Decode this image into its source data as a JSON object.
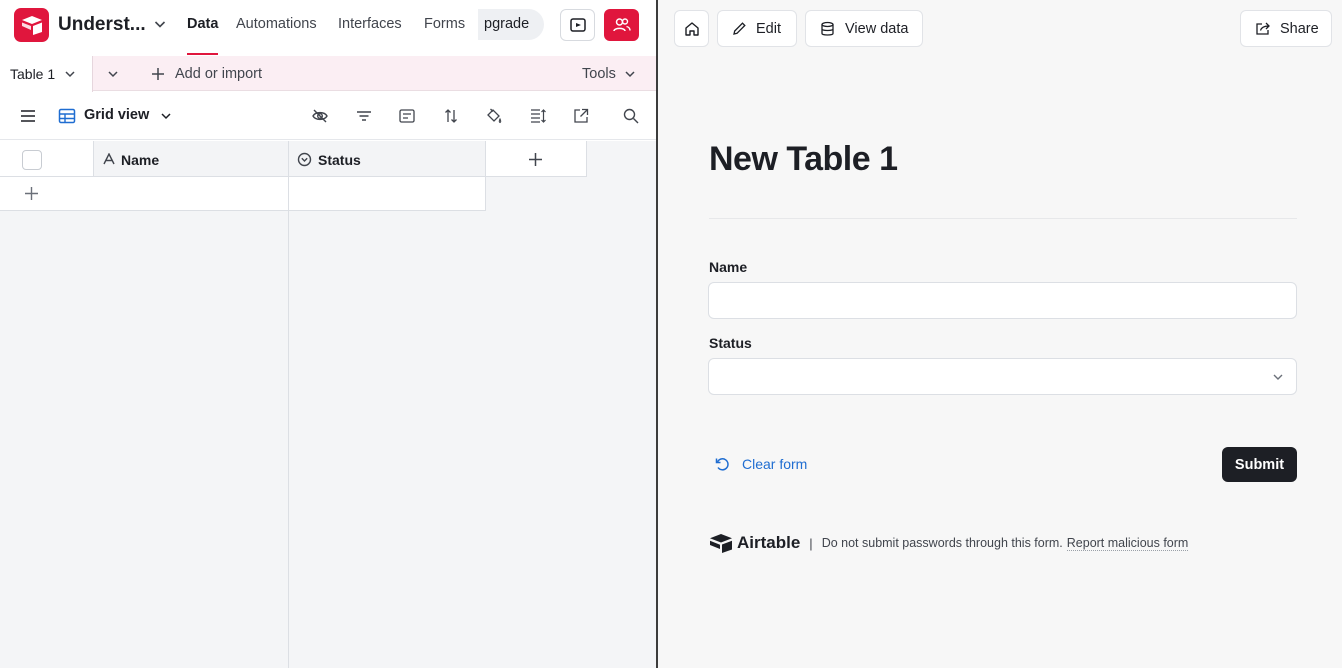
{
  "app": {
    "base_name": "Underst...",
    "nav": [
      "Data",
      "Automations",
      "Interfaces",
      "Forms"
    ],
    "active_nav": "Data",
    "upgrade_label": "pgrade",
    "accent_color": "#e0163d"
  },
  "table_bar": {
    "active_table": "Table 1",
    "add_import_label": "Add or import",
    "tools_label": "Tools"
  },
  "view_bar": {
    "view_name": "Grid view",
    "toolbar_icons": [
      "hide-fields-icon",
      "filter-icon",
      "group-icon",
      "sort-icon",
      "color-icon",
      "row-height-icon",
      "share-view-icon",
      "search-icon"
    ]
  },
  "grid": {
    "columns": [
      {
        "name": "Name",
        "icon": "text-field-icon"
      },
      {
        "name": "Status",
        "icon": "single-select-icon"
      }
    ],
    "rows": []
  },
  "form_toolbar": {
    "edit_label": "Edit",
    "view_data_label": "View data",
    "share_label": "Share"
  },
  "form": {
    "title": "New Table 1",
    "fields": [
      {
        "label": "Name",
        "type": "text",
        "value": ""
      },
      {
        "label": "Status",
        "type": "select",
        "value": ""
      }
    ],
    "clear_label": "Clear form",
    "submit_label": "Submit"
  },
  "footer": {
    "brand": "Airtable",
    "separator": "|",
    "notice": "Do not submit passwords through this form.",
    "report_label": "Report malicious form"
  }
}
